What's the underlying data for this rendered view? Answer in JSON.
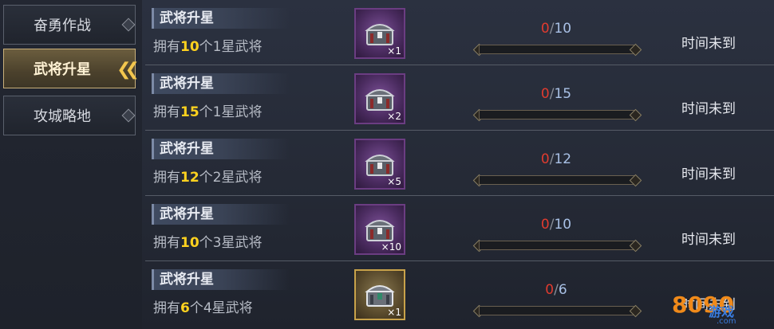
{
  "sidebar": {
    "items": [
      {
        "label": "奋勇作战",
        "active": false
      },
      {
        "label": "武将升星",
        "active": true
      },
      {
        "label": "攻城略地",
        "active": false
      }
    ]
  },
  "tasks": [
    {
      "title": "武将升星",
      "desc_pre": "拥有",
      "count": "10",
      "desc_post": "个1星武将",
      "reward_qty": "×1",
      "progress_current": "0",
      "progress_total": "10",
      "progress_sep": "/",
      "status": "时间未到",
      "chest": "purple"
    },
    {
      "title": "武将升星",
      "desc_pre": "拥有",
      "count": "15",
      "desc_post": "个1星武将",
      "reward_qty": "×2",
      "progress_current": "0",
      "progress_total": "15",
      "progress_sep": "/",
      "status": "时间未到",
      "chest": "purple"
    },
    {
      "title": "武将升星",
      "desc_pre": "拥有",
      "count": "12",
      "desc_post": "个2星武将",
      "reward_qty": "×5",
      "progress_current": "0",
      "progress_total": "12",
      "progress_sep": "/",
      "status": "时间未到",
      "chest": "purple"
    },
    {
      "title": "武将升星",
      "desc_pre": "拥有",
      "count": "10",
      "desc_post": "个3星武将",
      "reward_qty": "×10",
      "progress_current": "0",
      "progress_total": "10",
      "progress_sep": "/",
      "status": "时间未到",
      "chest": "purple"
    },
    {
      "title": "武将升星",
      "desc_pre": "拥有",
      "count": "6",
      "desc_post": "个4星武将",
      "reward_qty": "×1",
      "progress_current": "0",
      "progress_total": "6",
      "progress_sep": "/",
      "status": "时间未到",
      "chest": "gold"
    }
  ],
  "watermark": {
    "brand": "游戏",
    "logo_digits": "8090",
    "site": ".com"
  },
  "colors": {
    "highlight": "#ffd21f",
    "progress_current": "#e03b2f",
    "progress_total": "#a9c1e6"
  }
}
